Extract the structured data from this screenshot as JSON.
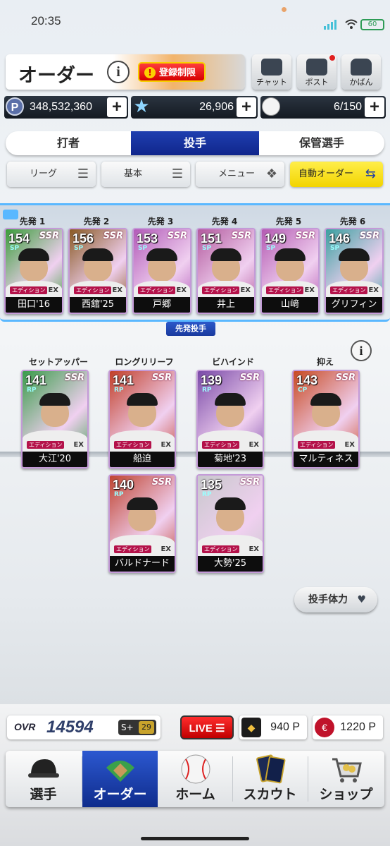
{
  "status_bar": {
    "time": "20:35",
    "battery": "60"
  },
  "header": {
    "title": "オーダー",
    "restriction_label": "登録制限",
    "buttons": [
      {
        "label": "チャット"
      },
      {
        "label": "ポスト"
      },
      {
        "label": "かばん"
      }
    ]
  },
  "currency": {
    "p_points": "348,532,360",
    "stars": "26,906",
    "balls": "6/150"
  },
  "tabs": [
    "打者",
    "投手",
    "保管選手"
  ],
  "filters": {
    "league": "リーグ",
    "basic": "基本",
    "menu": "メニュー",
    "auto": "自動オーダー"
  },
  "starters": {
    "section_label": "先発投手",
    "cards": [
      {
        "slot": "先発 1",
        "ovr": "154",
        "pos": "SP",
        "rarity": "SSR",
        "name": "田口'16",
        "bg": "#3a9d3a"
      },
      {
        "slot": "先発 2",
        "ovr": "156",
        "pos": "SP",
        "rarity": "SSR",
        "name": "西舘'25",
        "bg": "#8a5a24"
      },
      {
        "slot": "先発 3",
        "ovr": "153",
        "pos": "SP",
        "rarity": "SSR",
        "name": "戸郷",
        "bg": "#b25ab8"
      },
      {
        "slot": "先発 4",
        "ovr": "151",
        "pos": "SP",
        "rarity": "SSR",
        "name": "井上",
        "bg": "#b35a9e"
      },
      {
        "slot": "先発 5",
        "ovr": "149",
        "pos": "SP",
        "rarity": "SSR",
        "name": "山﨑",
        "bg": "#b45ab2"
      },
      {
        "slot": "先発 6",
        "ovr": "146",
        "pos": "SP",
        "rarity": "SSR",
        "name": "グリフィン",
        "bg": "#3aa0a0"
      }
    ],
    "edition_label": "エディション",
    "ex_label": "EX"
  },
  "relievers": {
    "setup_label": "セットアッパー",
    "long_label": "ロングリリーフ",
    "behind_label": "ビハインド",
    "closer_label": "抑え",
    "cards": [
      {
        "ovr": "141",
        "pos": "RP",
        "rarity": "SSR",
        "name": "大江'20",
        "bg": "#3a9d4a"
      },
      {
        "ovr": "141",
        "pos": "RP",
        "rarity": "SSR",
        "name": "船迫",
        "bg": "#c2402a"
      },
      {
        "ovr": "139",
        "pos": "RP",
        "rarity": "SSR",
        "name": "菊地'23",
        "bg": "#7a4aa8"
      },
      {
        "ovr": "143",
        "pos": "CP",
        "rarity": "SSR",
        "name": "マルティネス",
        "bg": "#c84a22"
      },
      {
        "ovr": "140",
        "pos": "RP",
        "rarity": "SSR",
        "name": "バルドナード",
        "bg": "#c04430"
      },
      {
        "ovr": "135",
        "pos": "RP",
        "rarity": "SSR",
        "name": "大勢'25",
        "bg": "#c8c8cc"
      }
    ],
    "stamina_label": "投手体力"
  },
  "bottom": {
    "ovr_label": "OVR",
    "ovr_value": "14594",
    "rank_label": "S+",
    "rank_value": "29",
    "live_label": "LIVE",
    "coin1": "940",
    "coin1_unit": "P",
    "coin2": "1220",
    "coin2_unit": "P"
  },
  "nav": [
    "選手",
    "オーダー",
    "ホーム",
    "スカウト",
    "ショップ"
  ]
}
